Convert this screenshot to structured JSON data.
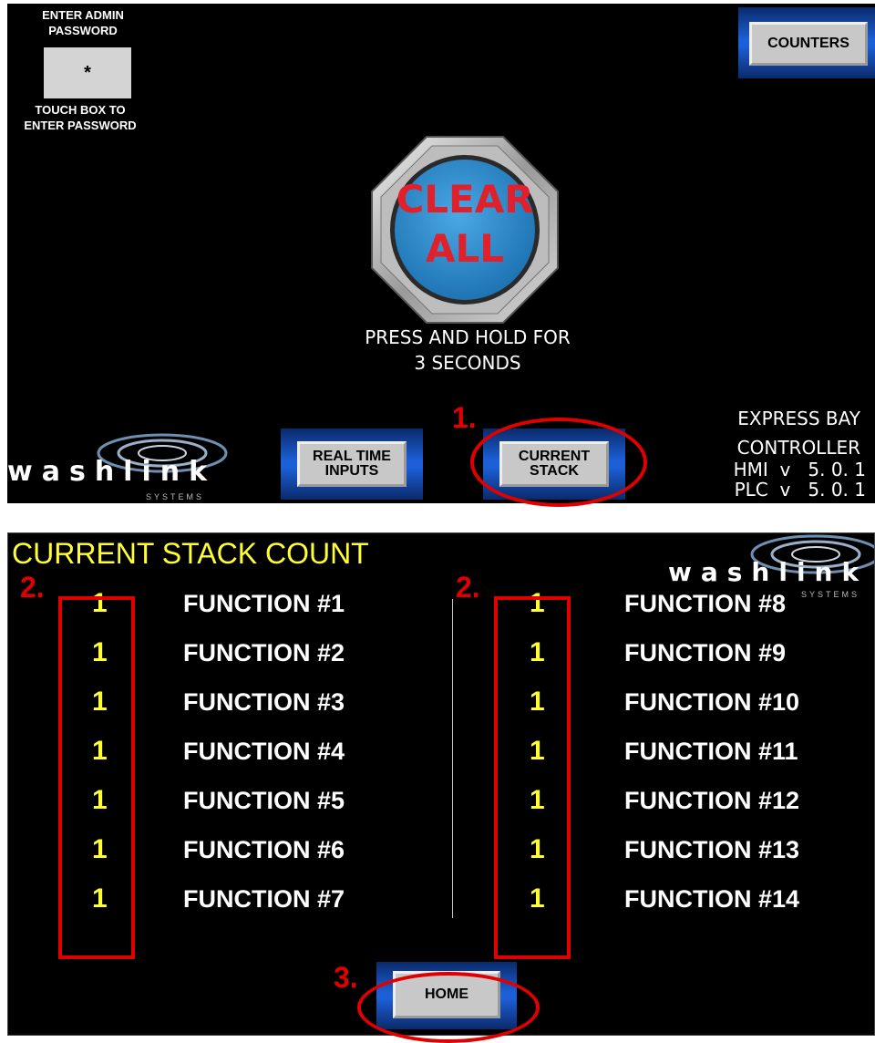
{
  "top_panel": {
    "password": {
      "prompt": "ENTER ADMIN\nPASSWORD",
      "value": "*",
      "hint": "TOUCH BOX TO\nENTER PASSWORD"
    },
    "counters_label": "COUNTERS",
    "clear_all_label": "CLEAR\nALL",
    "press_hold_text": "PRESS AND HOLD FOR\n3 SECONDS",
    "real_time_inputs_label": "REAL TIME\nINPUTS",
    "current_stack_label": "CURRENT\nSTACK",
    "logo": {
      "main": "washlink",
      "sub": "SYSTEMS"
    },
    "controller": {
      "line1": "EXPRESS BAY",
      "line2": "CONTROLLER",
      "hmi": "HMI  v   5. 0. 1",
      "plc": "PLC  v   5. 0. 1"
    }
  },
  "bottom_panel": {
    "title": "CURRENT STACK COUNT",
    "logo": {
      "main": "washlink",
      "sub": "SYSTEMS"
    },
    "left_column": [
      {
        "count": "1",
        "label": "FUNCTION #1"
      },
      {
        "count": "1",
        "label": "FUNCTION #2"
      },
      {
        "count": "1",
        "label": "FUNCTION #3"
      },
      {
        "count": "1",
        "label": "FUNCTION #4"
      },
      {
        "count": "1",
        "label": "FUNCTION #5"
      },
      {
        "count": "1",
        "label": "FUNCTION #6"
      },
      {
        "count": "1",
        "label": "FUNCTION #7"
      }
    ],
    "right_column": [
      {
        "count": "1",
        "label": "FUNCTION #8"
      },
      {
        "count": "1",
        "label": "FUNCTION #9"
      },
      {
        "count": "1",
        "label": "FUNCTION #10"
      },
      {
        "count": "1",
        "label": "FUNCTION #11"
      },
      {
        "count": "1",
        "label": "FUNCTION #12"
      },
      {
        "count": "1",
        "label": "FUNCTION #13"
      },
      {
        "count": "1",
        "label": "FUNCTION #14"
      }
    ],
    "home_label": "HOME"
  },
  "annotations": {
    "step1": "1.",
    "step2_left": "2.",
    "step2_right": "2.",
    "step3": "3."
  },
  "colors": {
    "panel_bg": "#000000",
    "annotation_red": "#e00000",
    "count_yellow": "#ffff33",
    "clear_button_blue": "#2f8fd0",
    "clear_text_red": "#e0202a"
  }
}
